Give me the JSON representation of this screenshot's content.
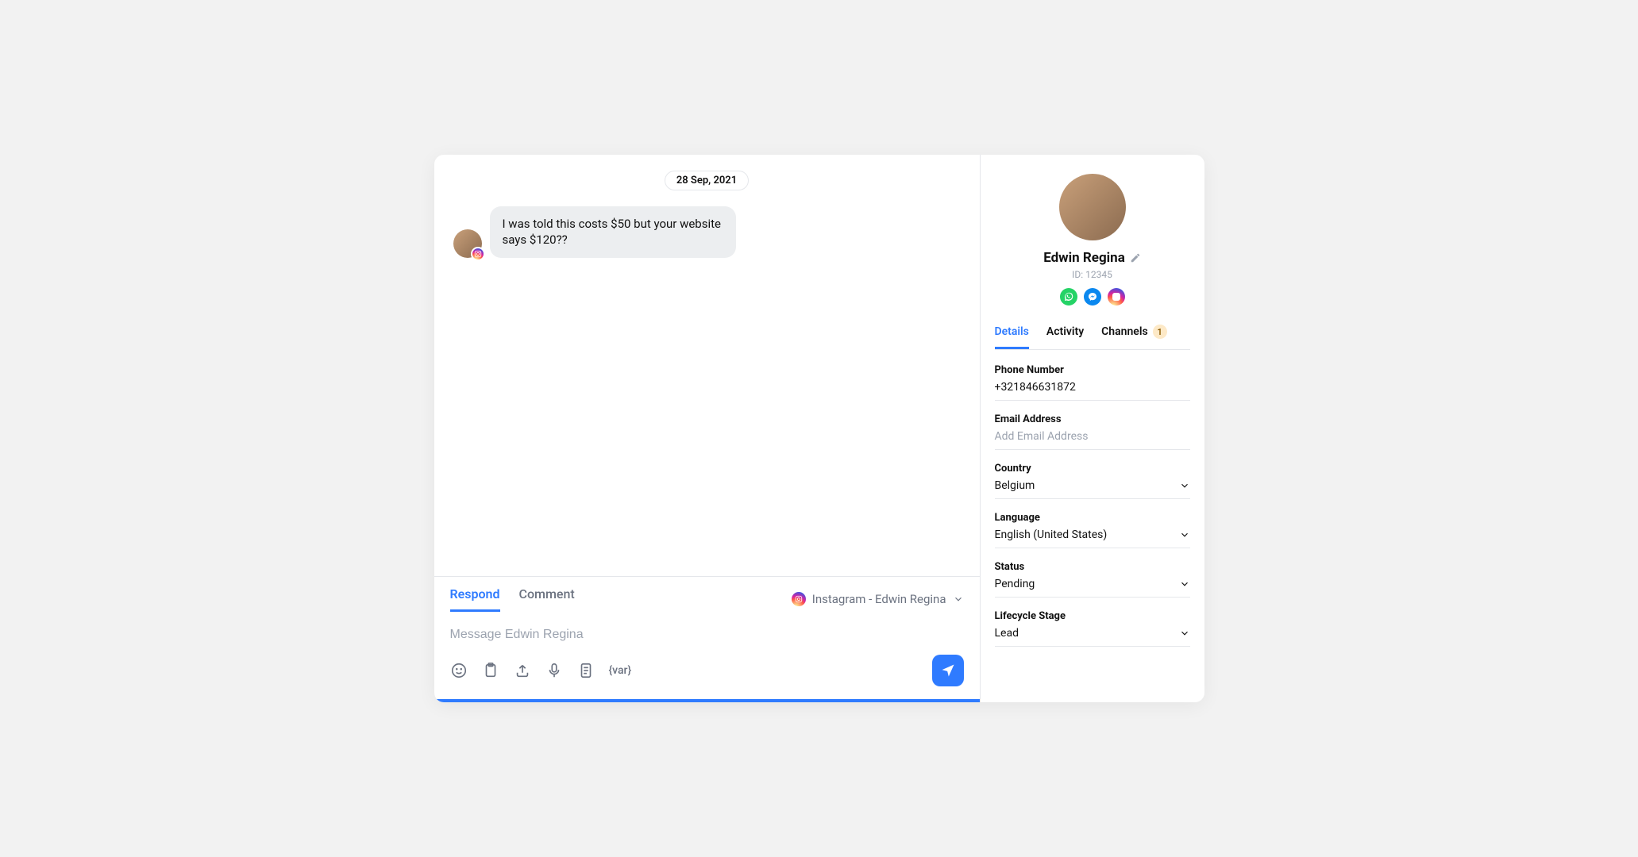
{
  "conversation": {
    "date": "28 Sep, 2021",
    "message": "I was told this costs $50 but your website says $120??"
  },
  "composer": {
    "tabs": {
      "respond": "Respond",
      "comment": "Comment"
    },
    "channel": "Instagram - Edwin Regina",
    "placeholder": "Message Edwin Regina",
    "var_label": "{var}"
  },
  "profile": {
    "name": "Edwin Regina",
    "id": "ID: 12345"
  },
  "side_tabs": {
    "details": "Details",
    "activity": "Activity",
    "channels": "Channels",
    "channels_count": "1"
  },
  "details": {
    "phone_label": "Phone Number",
    "phone_value": "+321846631872",
    "email_label": "Email Address",
    "email_placeholder": "Add Email Address",
    "country_label": "Country",
    "country_value": "Belgium",
    "language_label": "Language",
    "language_value": "English (United States)",
    "status_label": "Status",
    "status_value": "Pending",
    "lifecycle_label": "Lifecycle Stage",
    "lifecycle_value": "Lead"
  }
}
